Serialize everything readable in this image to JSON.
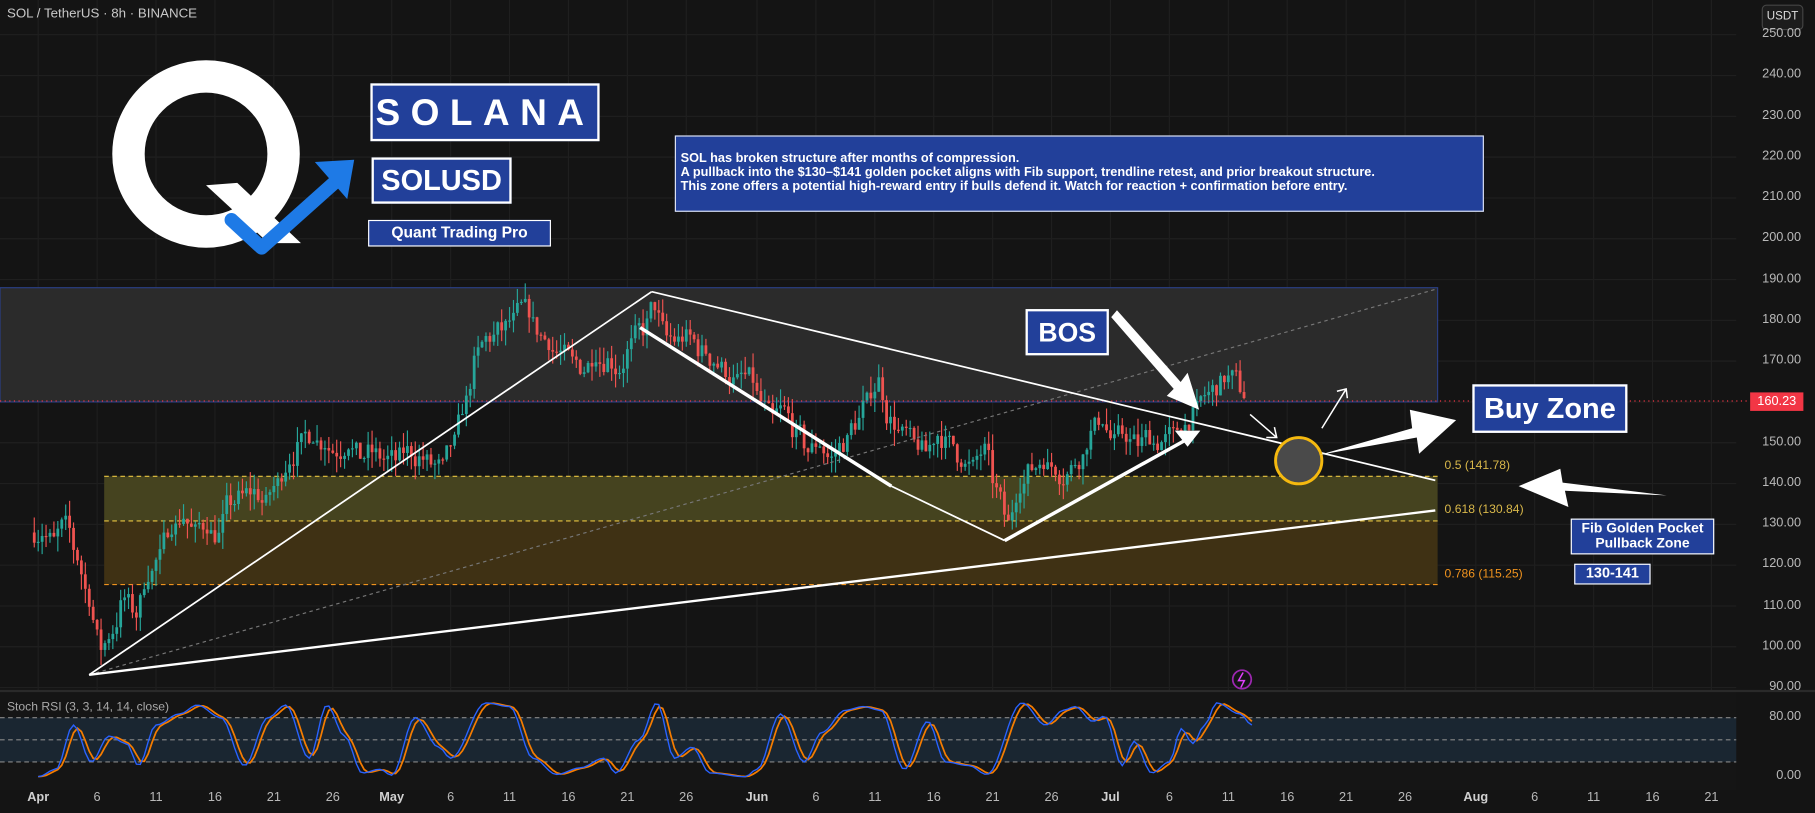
{
  "header": {
    "symbol": "SOL / TetherUS · 8h · BINANCE",
    "currency": "USDT"
  },
  "branding": {
    "title": "SOLANA",
    "ticker": "SOLUSD",
    "author": "Quant Trading Pro",
    "logo_text": "Q"
  },
  "note": {
    "lines": [
      "SOL has broken structure after months of compression.",
      "A pullback into the $130–$141 golden pocket aligns with Fib support, trendline retest, and prior breakout structure.",
      "This zone offers a potential high-reward entry if bulls defend it. Watch for reaction + confirmation before entry."
    ]
  },
  "labels": {
    "bos": "BOS",
    "buy_zone": "Buy Zone",
    "fib_zone_line1": "Fib Golden Pocket",
    "fib_zone_line2": "Pullback Zone",
    "range": "130-141"
  },
  "fib_levels": [
    {
      "label": "0.5 (141.78)",
      "price": 141.78,
      "color": "#e8c440"
    },
    {
      "label": "0.618 (130.84)",
      "price": 130.84,
      "color": "#e8c440"
    },
    {
      "label": "0.786 (115.25)",
      "price": 115.25,
      "color": "#f0931e"
    }
  ],
  "current_price": {
    "label": "160.23",
    "value": 160.23,
    "color": "#f23645"
  },
  "colors": {
    "up": "#26a69a",
    "down": "#ef5350",
    "accent": "#22409a",
    "k": "#2962ff",
    "d": "#f57c00"
  },
  "chart_data": {
    "type": "candlestick",
    "title": "SOL / TetherUS · 8h · BINANCE",
    "price_axis": {
      "ticks": [
        "250.00",
        "240.00",
        "230.00",
        "220.00",
        "210.00",
        "200.00",
        "190.00",
        "180.00",
        "170.00",
        "160.00",
        "150.00",
        "140.00",
        "130.00",
        "120.00",
        "110.00",
        "100.00",
        "90.00"
      ],
      "range": [
        90,
        250
      ]
    },
    "time_axis": {
      "ticks": [
        {
          "label": "Apr",
          "day": 0,
          "bold": true
        },
        {
          "label": "6",
          "day": 5
        },
        {
          "label": "11",
          "day": 10
        },
        {
          "label": "16",
          "day": 15
        },
        {
          "label": "21",
          "day": 20
        },
        {
          "label": "26",
          "day": 25
        },
        {
          "label": "May",
          "day": 30,
          "bold": true
        },
        {
          "label": "6",
          "day": 35
        },
        {
          "label": "11",
          "day": 40
        },
        {
          "label": "16",
          "day": 45
        },
        {
          "label": "21",
          "day": 50
        },
        {
          "label": "26",
          "day": 55
        },
        {
          "label": "Jun",
          "day": 61,
          "bold": true
        },
        {
          "label": "6",
          "day": 66
        },
        {
          "label": "11",
          "day": 71
        },
        {
          "label": "16",
          "day": 76
        },
        {
          "label": "21",
          "day": 81
        },
        {
          "label": "26",
          "day": 86
        },
        {
          "label": "Jul",
          "day": 91,
          "bold": true
        },
        {
          "label": "6",
          "day": 96
        },
        {
          "label": "11",
          "day": 101
        },
        {
          "label": "16",
          "day": 106
        },
        {
          "label": "21",
          "day": 111
        },
        {
          "label": "26",
          "day": 116
        },
        {
          "label": "Aug",
          "day": 122,
          "bold": true
        },
        {
          "label": "6",
          "day": 127
        },
        {
          "label": "11",
          "day": 132
        },
        {
          "label": "16",
          "day": 137
        },
        {
          "label": "21",
          "day": 142
        }
      ]
    },
    "daily_close_from_apr1": [
      128,
      126,
      130,
      122,
      112,
      100,
      104,
      112,
      108,
      118,
      122,
      130,
      132,
      128,
      130,
      127,
      136,
      137,
      138,
      135,
      140,
      146,
      150,
      152,
      150,
      148,
      150,
      147,
      148,
      146,
      146,
      148,
      146,
      145,
      144,
      150,
      160,
      172,
      176,
      178,
      180,
      183,
      178,
      175,
      172,
      170,
      168,
      172,
      170,
      168,
      174,
      178,
      184,
      176,
      175,
      176,
      172,
      170,
      168,
      165,
      166,
      160,
      156,
      158,
      152,
      148,
      150,
      146,
      150,
      155,
      160,
      165,
      155,
      152,
      150,
      148,
      152,
      150,
      146,
      144,
      148,
      138,
      130,
      140,
      144,
      146,
      144,
      142,
      146,
      152,
      156,
      150,
      152,
      150,
      152,
      150,
      152,
      154,
      158,
      162,
      164,
      166,
      162
    ],
    "stoch_rsi": {
      "label": "Stoch RSI (3, 3, 14, 14, close)",
      "ticks": [
        "80.00",
        "0.00"
      ],
      "bands": [
        80,
        50,
        20
      ],
      "k_points": [
        [
          0,
          0
        ],
        [
          1.5,
          10
        ],
        [
          3,
          70
        ],
        [
          4.5,
          20
        ],
        [
          6,
          55
        ],
        [
          7.5,
          45
        ],
        [
          8.5,
          15
        ],
        [
          10,
          70
        ],
        [
          12,
          85
        ],
        [
          13.5,
          97
        ],
        [
          15.5,
          80
        ],
        [
          17.5,
          15
        ],
        [
          19.5,
          80
        ],
        [
          21,
          97
        ],
        [
          23,
          25
        ],
        [
          24.5,
          97
        ],
        [
          26,
          55
        ],
        [
          27.5,
          5
        ],
        [
          29,
          10
        ],
        [
          30,
          2
        ],
        [
          32,
          80
        ],
        [
          34,
          40
        ],
        [
          35,
          25
        ],
        [
          38,
          100
        ],
        [
          40,
          95
        ],
        [
          42,
          25
        ],
        [
          44,
          3
        ],
        [
          46,
          12
        ],
        [
          48,
          25
        ],
        [
          49,
          5
        ],
        [
          51,
          50
        ],
        [
          52.5,
          100
        ],
        [
          54,
          25
        ],
        [
          55.5,
          40
        ],
        [
          57,
          5
        ],
        [
          60,
          0
        ],
        [
          61,
          10
        ],
        [
          63,
          85
        ],
        [
          65,
          20
        ],
        [
          66.5,
          60
        ],
        [
          68.5,
          90
        ],
        [
          70,
          95
        ],
        [
          71.5,
          90
        ],
        [
          73.5,
          10
        ],
        [
          75.5,
          75
        ],
        [
          77,
          20
        ],
        [
          79,
          15
        ],
        [
          80.5,
          3
        ],
        [
          83.5,
          100
        ],
        [
          85.5,
          70
        ],
        [
          87,
          90
        ],
        [
          88,
          95
        ],
        [
          89.5,
          75
        ],
        [
          90.5,
          82
        ],
        [
          92,
          15
        ],
        [
          93,
          48
        ],
        [
          94.5,
          5
        ],
        [
          96,
          20
        ],
        [
          97,
          65
        ],
        [
          98,
          45
        ],
        [
          99,
          70
        ],
        [
          100,
          100
        ],
        [
          102,
          85
        ],
        [
          103,
          70
        ]
      ]
    }
  }
}
